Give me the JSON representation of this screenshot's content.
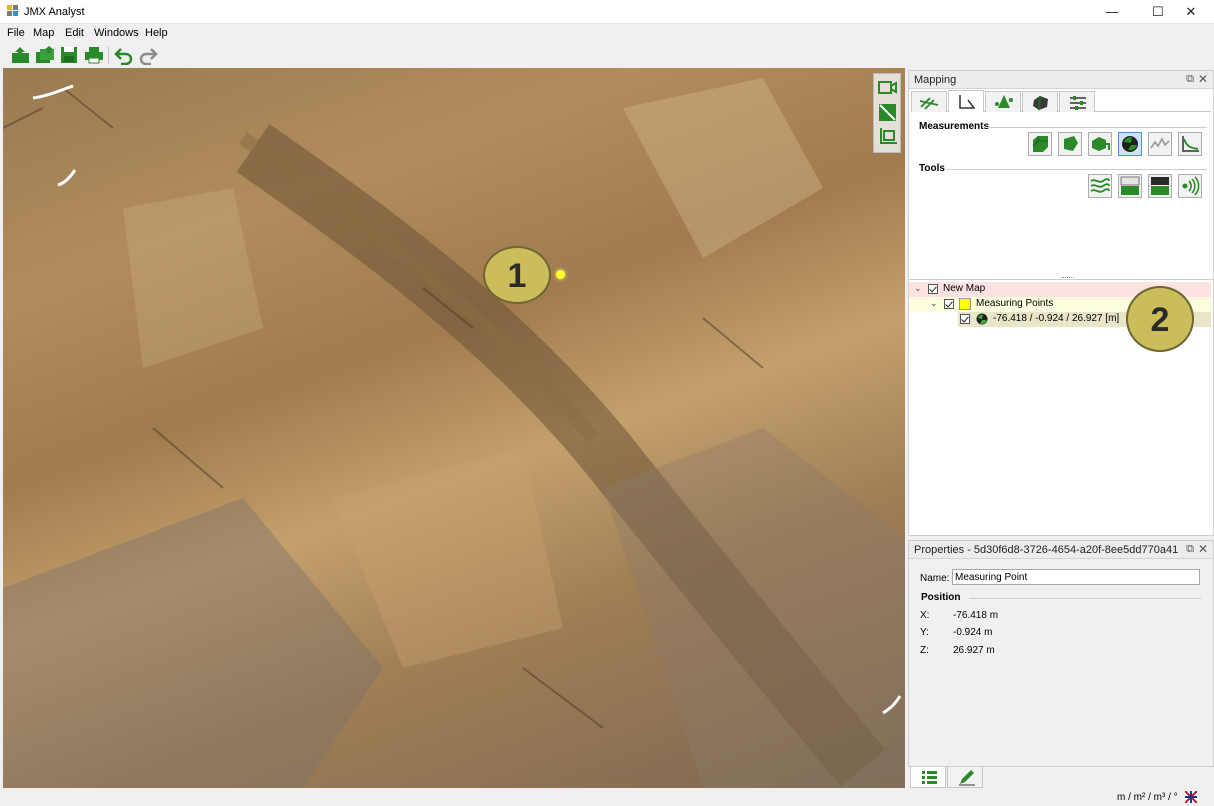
{
  "app": {
    "title": "JMX Analyst"
  },
  "window_controls": {
    "minimize": "—",
    "maximize": "☐",
    "close": "✕"
  },
  "menu": [
    "File",
    "Map",
    "Edit",
    "Windows",
    "Help"
  ],
  "toolbar_icons": [
    "open-icon",
    "import-icon",
    "save-icon",
    "print-icon",
    "undo-icon",
    "redo-icon"
  ],
  "viewport": {
    "view_tool_icons": [
      "camera-icon",
      "section-icon",
      "crop-icon"
    ],
    "callout": "1"
  },
  "mapping_panel": {
    "title": "Mapping",
    "float_glyph": "⧉",
    "close_glyph": "✕",
    "tab_icons": [
      "structure-icon",
      "measure-icon",
      "points-icon",
      "volume-icon",
      "settings-icon"
    ],
    "measurements_label": "Measurements",
    "measurement_icons": [
      "volume-measure-icon",
      "area-measure-icon",
      "surface-measure-icon",
      "point-measure-icon",
      "profile-measure-icon",
      "distance-measure-icon"
    ],
    "tools_label": "Tools",
    "tool_icons": [
      "layers-icon",
      "cut-lower-icon",
      "cut-upper-icon",
      "wave-icon"
    ]
  },
  "tree": {
    "root": {
      "label": "New Map",
      "expanded_glyph": "⌄"
    },
    "group": {
      "label": "Measuring Points",
      "expanded_glyph": "⌄",
      "color": "#ffff00"
    },
    "item": {
      "label": "-76.418 / -0.924 / 26.927 [m]"
    },
    "callout": "2"
  },
  "properties_panel": {
    "title": "Properties - 5d30f6d8-3726-4654-a20f-8ee5dd770a41",
    "float_glyph": "⧉",
    "close_glyph": "✕",
    "name_label": "Name:",
    "name_value": "Measuring Point",
    "position_label": "Position",
    "x_label": "X:",
    "x_value": "-76.418 m",
    "y_label": "Y:",
    "y_value": "-0.924 m",
    "z_label": "Z:",
    "z_value": "26.927 m"
  },
  "bottom_tab_icons": [
    "list-icon",
    "edit-icon"
  ],
  "status": {
    "units": "m / m² / m³ / °",
    "flag_icon": "flag-icon"
  },
  "colors": {
    "accent_green": "#2f8a2f",
    "callout": "#cbbd5c",
    "root_row": "#fde2e2",
    "group_row": "#fdfde0",
    "item_row": "#e9e5c8"
  }
}
